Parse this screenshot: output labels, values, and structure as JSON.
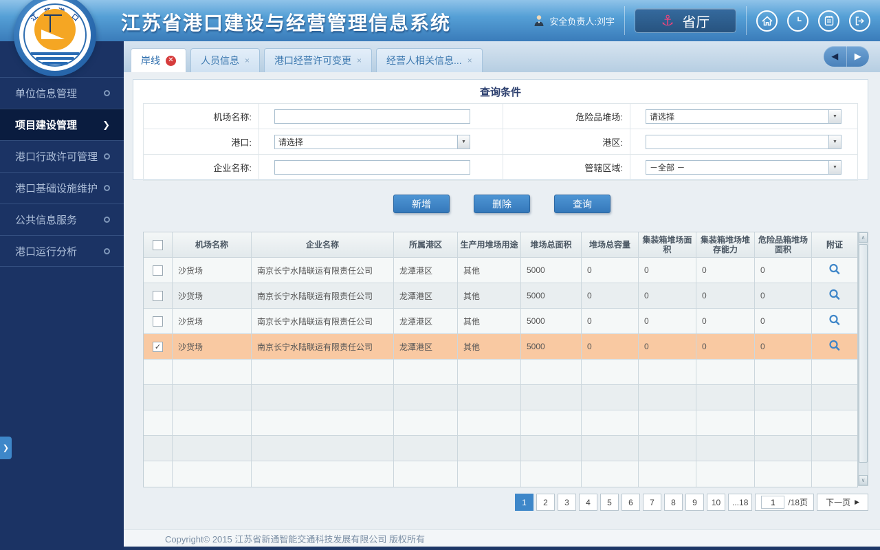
{
  "colors": {
    "header_blue": "#3a7cba",
    "accent_button": "#3e87c9",
    "selected_row": "#f9c9a2",
    "sidebar_navy": "#1b3364",
    "close_red": "#d63c3c",
    "anchor_pink": "#e8457d"
  },
  "header": {
    "title": "江苏省港口建设与经营管理信息系统",
    "user_label": "安全负责人:刘宇",
    "dept_button_label": "省厅",
    "logo_arc_chars": [
      "江",
      "苏",
      "港",
      "口"
    ]
  },
  "tabs": {
    "items": [
      {
        "label": "岸线",
        "active": true
      },
      {
        "label": "人员信息",
        "active": false
      },
      {
        "label": "港口经营许可变更",
        "active": false
      },
      {
        "label": "经营人相关信息...",
        "active": false
      }
    ]
  },
  "sidebar": {
    "items": [
      {
        "label": "单位信息管理",
        "active": false
      },
      {
        "label": "项目建设管理",
        "active": true
      },
      {
        "label": "港口行政许可管理",
        "active": false
      },
      {
        "label": "港口基础设施维护",
        "active": false
      },
      {
        "label": "公共信息服务",
        "active": false
      },
      {
        "label": "港口运行分析",
        "active": false
      }
    ]
  },
  "query": {
    "title": "查询条件",
    "rows": [
      {
        "left": {
          "label": "机场名称:",
          "type": "text",
          "value": ""
        },
        "right": {
          "label": "危险品堆场:",
          "type": "select",
          "value": "请选择"
        }
      },
      {
        "left": {
          "label": "港口:",
          "type": "select",
          "value": "请选择"
        },
        "right": {
          "label": "港区:",
          "type": "select",
          "value": ""
        }
      },
      {
        "left": {
          "label": "企业名称:",
          "type": "text",
          "value": ""
        },
        "right": {
          "label": "管辖区域:",
          "type": "select",
          "value": "－全部 －"
        }
      }
    ],
    "buttons": [
      "新增",
      "删除",
      "查询"
    ]
  },
  "table": {
    "headers": [
      "机场名称",
      "企业名称",
      "所属港区",
      "生产用堆场用途",
      "堆场总面积",
      "堆场总容量",
      "集装箱堆场面积",
      "集装箱堆场堆存能力",
      "危险品箱堆场面积",
      "附证"
    ],
    "rows": [
      {
        "checked": false,
        "selected": false,
        "cells": [
          "沙货场",
          "南京长宁水陆联运有限责任公司",
          "龙潭港区",
          "其他",
          "5000",
          "0",
          "0",
          "0",
          "0"
        ]
      },
      {
        "checked": false,
        "selected": false,
        "cells": [
          "沙货场",
          "南京长宁水陆联运有限责任公司",
          "龙潭港区",
          "其他",
          "5000",
          "0",
          "0",
          "0",
          "0"
        ]
      },
      {
        "checked": false,
        "selected": false,
        "cells": [
          "沙货场",
          "南京长宁水陆联运有限责任公司",
          "龙潭港区",
          "其他",
          "5000",
          "0",
          "0",
          "0",
          "0"
        ]
      },
      {
        "checked": true,
        "selected": true,
        "cells": [
          "沙货场",
          "南京长宁水陆联运有限责任公司",
          "龙潭港区",
          "其他",
          "5000",
          "0",
          "0",
          "0",
          "0"
        ]
      }
    ],
    "empty_rows": 5
  },
  "pagination": {
    "pages": [
      "1",
      "2",
      "3",
      "4",
      "5",
      "6",
      "7",
      "8",
      "9",
      "10",
      "...18"
    ],
    "current": "1",
    "jump_value": "1",
    "total_label": "/18页",
    "next_label": "下一页"
  },
  "footer": {
    "copyright": "Copyright©  2015  江苏省新通智能交通科技发展有限公司  版权所有"
  }
}
